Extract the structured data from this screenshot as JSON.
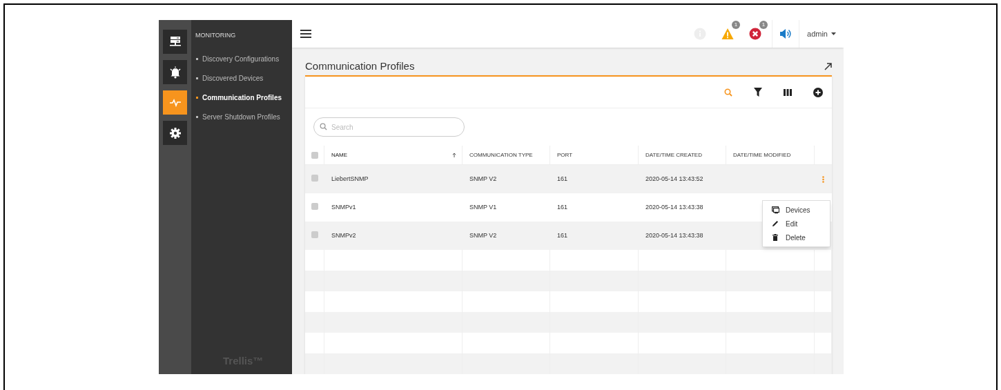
{
  "rail": [
    {
      "selected": false
    },
    {
      "selected": false
    },
    {
      "selected": true
    },
    {
      "selected": false
    }
  ],
  "nav": {
    "heading": "MONITORING",
    "items": [
      {
        "label": "Discovery Configurations",
        "selected": false
      },
      {
        "label": "Discovered Devices",
        "selected": false
      },
      {
        "label": "Communication Profiles",
        "selected": true
      },
      {
        "label": "Server Shutdown Profiles",
        "selected": false
      }
    ]
  },
  "brand": "Trellis™",
  "topbar": {
    "alerts": [
      {
        "kind": "info"
      },
      {
        "kind": "warning",
        "count": "1"
      },
      {
        "kind": "error",
        "count": "1"
      }
    ],
    "user": "admin"
  },
  "page_title": "Communication Profiles",
  "search": {
    "placeholder": "Search"
  },
  "table": {
    "all_checked": false,
    "columns": [
      {
        "label": "NAME",
        "sorted": true
      },
      {
        "label": "COMMUNICATION TYPE",
        "sorted": false
      },
      {
        "label": "PORT",
        "sorted": false
      },
      {
        "label": "DATE/TIME CREATED",
        "sorted": false
      },
      {
        "label": "DATE/TIME MODIFIED",
        "sorted": false
      }
    ],
    "rows": [
      {
        "cells": [
          "LiebertSNMP",
          "SNMP V2",
          "161",
          "2020-05-14 13:43:52",
          ""
        ],
        "checked": false,
        "menu_open": true
      },
      {
        "cells": [
          "SNMPv1",
          "SNMP V1",
          "161",
          "2020-05-14 13:43:38",
          ""
        ],
        "checked": false,
        "menu_open": false
      },
      {
        "cells": [
          "SNMPv2",
          "SNMP V2",
          "161",
          "2020-05-14 13:43:38",
          ""
        ],
        "checked": false,
        "menu_open": false
      }
    ]
  },
  "row_menu": [
    {
      "label": "Devices"
    },
    {
      "label": "Edit"
    },
    {
      "label": "Delete"
    }
  ]
}
